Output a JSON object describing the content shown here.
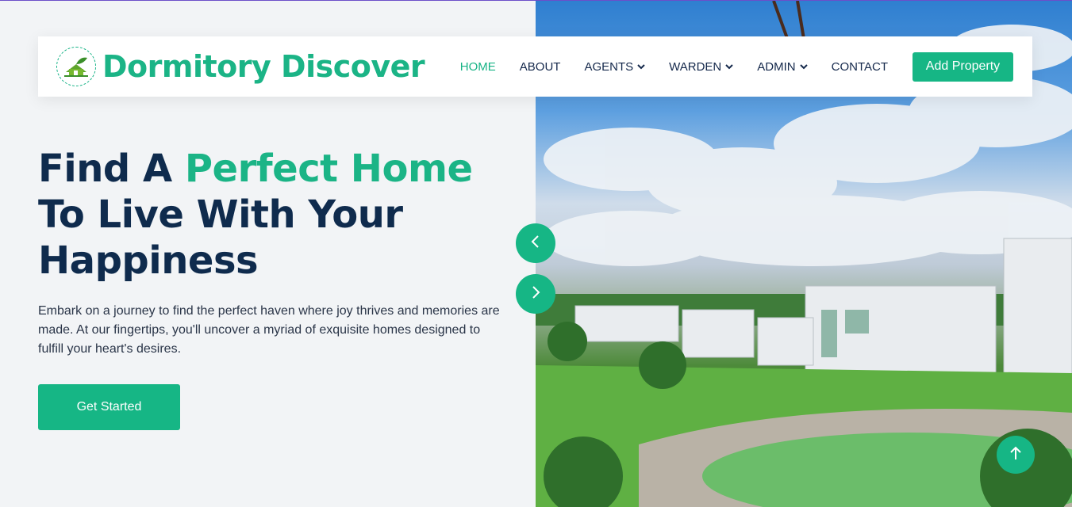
{
  "brand": {
    "name": "Dormitory Discover",
    "logo_icon": "home-leaf-logo"
  },
  "nav": {
    "items": [
      {
        "label": "HOME",
        "active": true,
        "dropdown": false
      },
      {
        "label": "ABOUT",
        "active": false,
        "dropdown": false
      },
      {
        "label": "AGENTS",
        "active": false,
        "dropdown": true
      },
      {
        "label": "WARDEN",
        "active": false,
        "dropdown": true
      },
      {
        "label": "ADMIN",
        "active": false,
        "dropdown": true
      },
      {
        "label": "CONTACT",
        "active": false,
        "dropdown": false
      }
    ],
    "cta_label": "Add Property"
  },
  "hero": {
    "title_part1": "Find A ",
    "title_accent": "Perfect Home",
    "title_part2": " To Live With Your Happiness",
    "description": "Embark on a journey to find the perfect haven where joy thrives and memories are made. At our fingertips, you'll uncover a myriad of exquisite homes designed to fulfill your heart's desires.",
    "button_label": "Get Started"
  },
  "carousel": {
    "prev_icon": "chevron-left-icon",
    "next_icon": "chevron-right-icon"
  },
  "back_to_top_icon": "arrow-up-icon",
  "colors": {
    "accent": "#16b685",
    "heading": "#0f2b4d",
    "background": "#f2f4f6"
  }
}
